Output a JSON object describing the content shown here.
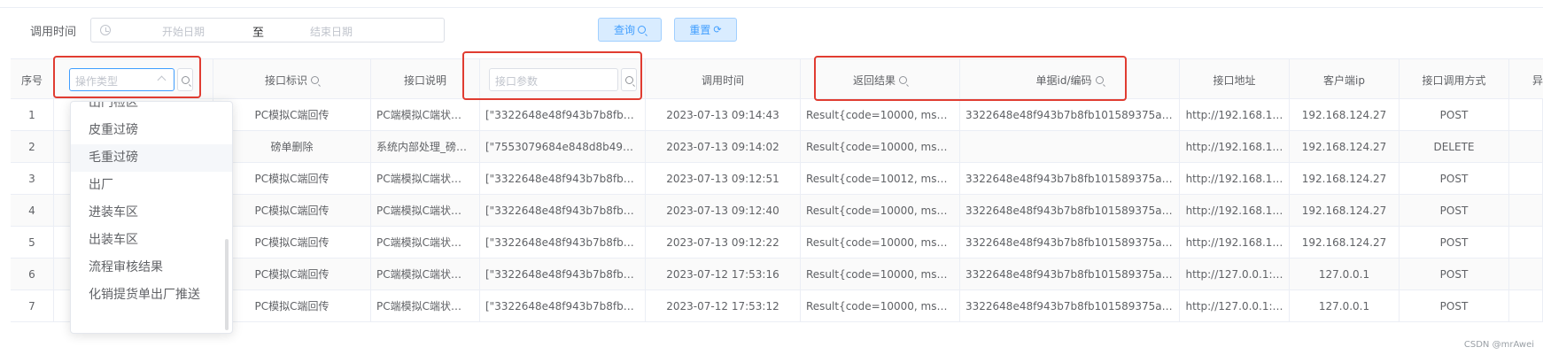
{
  "filter": {
    "label": "调用时间",
    "start_placeholder": "开始日期",
    "separator": "至",
    "end_placeholder": "结束日期",
    "query_label": "查询",
    "reset_label": "重置"
  },
  "table": {
    "headers": {
      "index": "序号",
      "op_type_placeholder": "操作类型",
      "interface_id": "接口标识",
      "interface_desc": "接口说明",
      "interface_params_placeholder": "接口参数",
      "call_time": "调用时间",
      "return_result": "返回结果",
      "bill_id": "单据id/编码",
      "interface_url": "接口地址",
      "client_ip": "客户端ip",
      "call_method": "接口调用方式",
      "extra": "异"
    },
    "rows": [
      {
        "index": "1",
        "interface_id": "PC模拟C端回传",
        "interface_desc": "PC端模拟C端状…",
        "params": "[\"3322648e48f943b7b8fb10…",
        "call_time": "2023-07-13 09:14:43",
        "result": "Result{code=10000, msg='…",
        "bill_id": "3322648e48f943b7b8fb101589375a46",
        "url": "http://192.168.1…",
        "ip": "192.168.124.27",
        "method": "POST"
      },
      {
        "index": "2",
        "interface_id": "磅单删除",
        "interface_desc": "系统内部处理_磅…",
        "params": "[\"7553079684e848d8b492d…",
        "call_time": "2023-07-13 09:14:02",
        "result": "Result{code=10000, msg='…",
        "bill_id": "",
        "url": "http://192.168.1…",
        "ip": "192.168.124.27",
        "method": "DELETE"
      },
      {
        "index": "3",
        "interface_id": "PC模拟C端回传",
        "interface_desc": "PC端模拟C端状…",
        "params": "[\"3322648e48f943b7b8fb10…",
        "call_time": "2023-07-13 09:12:51",
        "result": "Result{code=10012, msg='…",
        "bill_id": "3322648e48f943b7b8fb101589375a46",
        "url": "http://192.168.1…",
        "ip": "192.168.124.27",
        "method": "POST"
      },
      {
        "index": "4",
        "interface_id": "PC模拟C端回传",
        "interface_desc": "PC端模拟C端状…",
        "params": "[\"3322648e48f943b7b8fb10…",
        "call_time": "2023-07-13 09:12:40",
        "result": "Result{code=10000, msg='…",
        "bill_id": "3322648e48f943b7b8fb101589375a46",
        "url": "http://192.168.1…",
        "ip": "192.168.124.27",
        "method": "POST"
      },
      {
        "index": "5",
        "interface_id": "PC模拟C端回传",
        "interface_desc": "PC端模拟C端状…",
        "params": "[\"3322648e48f943b7b8fb10…",
        "call_time": "2023-07-13 09:12:22",
        "result": "Result{code=10000, msg='…",
        "bill_id": "3322648e48f943b7b8fb101589375a46",
        "url": "http://192.168.1…",
        "ip": "192.168.124.27",
        "method": "POST"
      },
      {
        "index": "6",
        "interface_id": "PC模拟C端回传",
        "interface_desc": "PC端模拟C端状…",
        "params": "[\"3322648e48f943b7b8fb10…",
        "call_time": "2023-07-12 17:53:16",
        "result": "Result{code=10000, msg='…",
        "bill_id": "3322648e48f943b7b8fb101589375a46",
        "url": "http://127.0.0.1:…",
        "ip": "127.0.0.1",
        "method": "POST"
      },
      {
        "index": "7",
        "interface_id": "PC模拟C端回传",
        "interface_desc": "PC端模拟C端状…",
        "params": "[\"3322648e48f943b7b8fb10…",
        "call_time": "2023-07-12 17:53:12",
        "result": "Result{code=10000, msg='…",
        "bill_id": "3322648e48f943b7b8fb101589375a46",
        "url": "http://127.0.0.1:…",
        "ip": "127.0.0.1",
        "method": "POST"
      }
    ]
  },
  "dropdown": {
    "items": [
      "出门检区",
      "皮重过磅",
      "毛重过磅",
      "出厂",
      "进装车区",
      "出装车区",
      "流程审核结果",
      "化销提货单出厂推送"
    ],
    "hovered": "毛重过磅"
  },
  "colors": {
    "accent": "#409eff",
    "highlight": "#e03c31"
  },
  "watermark": "CSDN @mrAwei"
}
